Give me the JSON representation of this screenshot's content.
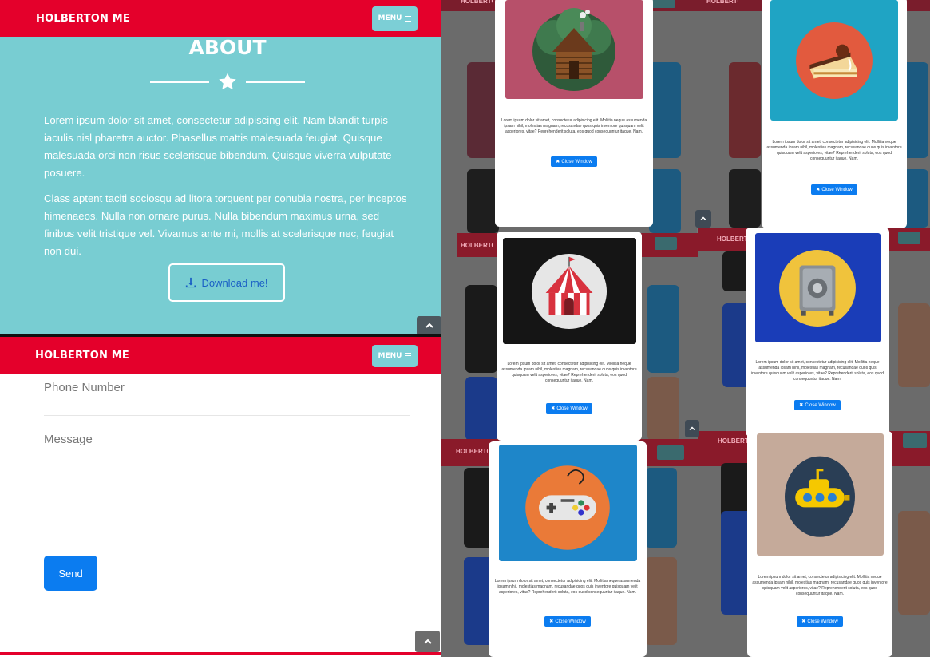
{
  "nav": {
    "brand": "HOLBERTON ME",
    "menu": "MENU"
  },
  "about": {
    "title": "ABOUT",
    "p1": "Lorem ipsum dolor sit amet, consectetur adipiscing elit. Nam blandit turpis iaculis nisl pharetra auctor. Phasellus mattis malesuada feugiat. Quisque malesuada orci non risus scelerisque bibendum. Quisque viverra vulputate posuere.",
    "p2": "Class aptent taciti sociosqu ad litora torquent per conubia nostra, per inceptos himenaeos. Nulla non ornare purus. Nulla bibendum maximus urna, sed finibus velit tristique vel. Vivamus ante mi, mollis at scelerisque nec, feugiat non dui.",
    "download": "Download me!"
  },
  "contact": {
    "phone_placeholder": "Phone Number",
    "message_placeholder": "Message",
    "send": "Send"
  },
  "modal": {
    "text": "Lorem ipsum dolor sit amet, consectetur adipisicing elit. Mollitia neque assumenda ipsam nihil, molestias magnam, recusandae quos quis inventore quisquam velit asperiores, vitae? Reprehenderit soluta, eos quod consequuntur itaque. Nam.",
    "close": "Close Window"
  },
  "colors": {
    "primary": "#e4002b",
    "teal": "#78cdd2",
    "blue_btn": "#0b7cf0"
  },
  "icons": {
    "star": "star-icon",
    "download": "download-icon",
    "chevron": "chevron-up-icon"
  }
}
